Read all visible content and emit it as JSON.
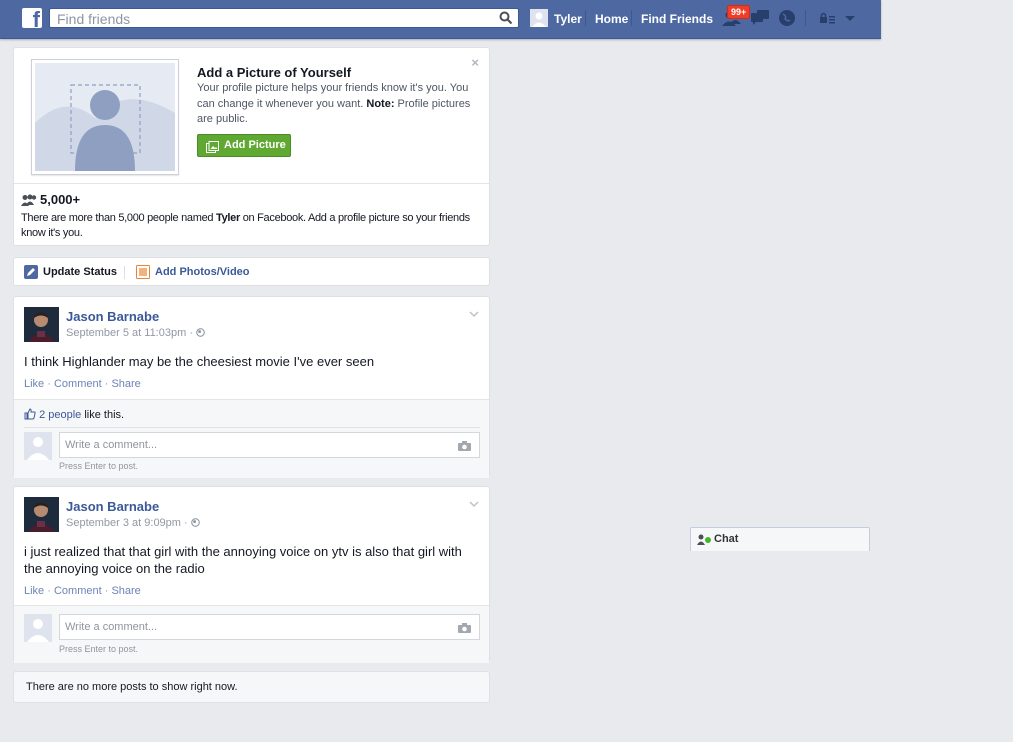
{
  "topbar": {
    "logo": "f",
    "search_placeholder": "Find friends",
    "user_name": "Tyler",
    "home": "Home",
    "find_friends": "Find Friends",
    "notification_badge": "99+"
  },
  "profile_prompt": {
    "title": "Add a Picture of Yourself",
    "desc_1": "Your profile picture helps your friends know it's you. You can change it whenever you want. ",
    "desc_bold": "Note:",
    "desc_2": " Profile pictures are public.",
    "button": "Add Picture",
    "close": "×",
    "count": "5,000+",
    "count_desc_1": "There are more than 5,000 people named ",
    "count_desc_bold": "Tyler",
    "count_desc_2": " on Facebook. Add a profile picture so your friends know it's you."
  },
  "composer": {
    "update_status": "Update Status",
    "add_photos": "Add Photos/Video"
  },
  "posts": [
    {
      "author": "Jason Barnabe",
      "time": "September 5 at 11:03pm · ",
      "text": "I think Highlander may be the cheesiest movie I've ever seen",
      "like": "Like",
      "comment": "Comment",
      "share": "Share",
      "likes_link": "2 people",
      "likes_text": " like this.",
      "comment_placeholder": "Write a comment...",
      "hint": "Press Enter to post."
    },
    {
      "author": "Jason Barnabe",
      "time": "September 3 at 9:09pm · ",
      "text": "i just realized that that girl with the annoying voice on ytv is also that girl with the annoying voice on the radio",
      "like": "Like",
      "comment": "Comment",
      "share": "Share",
      "comment_placeholder": "Write a comment...",
      "hint": "Press Enter to post."
    }
  ],
  "no_more_posts": "There are no more posts to show right now.",
  "chat": {
    "label": "Chat"
  }
}
